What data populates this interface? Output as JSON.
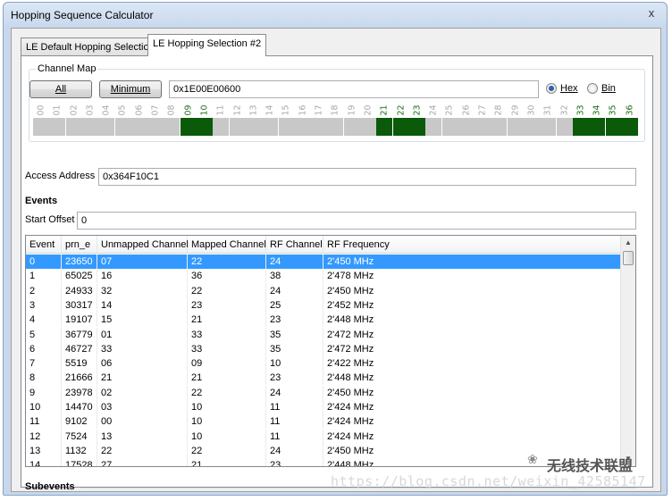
{
  "window": {
    "title": "Hopping Sequence Calculator",
    "close_glyph": "x"
  },
  "tabs": [
    {
      "label": "LE Default Hopping Selection",
      "active": false
    },
    {
      "label": "LE Hopping Selection #2",
      "active": true
    }
  ],
  "channel_map": {
    "group_title": "Channel Map",
    "all_label": "All",
    "minimum_label": "Minimum",
    "value": "0x1E00E00600",
    "hex_label": "Hex",
    "bin_label": "Bin",
    "selected_format": "Hex",
    "channels": [
      {
        "n": "00",
        "on": false
      },
      {
        "n": "01",
        "on": false
      },
      {
        "n": "02",
        "on": false
      },
      {
        "n": "03",
        "on": false
      },
      {
        "n": "04",
        "on": false
      },
      {
        "n": "05",
        "on": false
      },
      {
        "n": "06",
        "on": false
      },
      {
        "n": "07",
        "on": false
      },
      {
        "n": "08",
        "on": false
      },
      {
        "n": "09",
        "on": true
      },
      {
        "n": "10",
        "on": true
      },
      {
        "n": "11",
        "on": false
      },
      {
        "n": "12",
        "on": false
      },
      {
        "n": "13",
        "on": false
      },
      {
        "n": "14",
        "on": false
      },
      {
        "n": "15",
        "on": false
      },
      {
        "n": "16",
        "on": false
      },
      {
        "n": "17",
        "on": false
      },
      {
        "n": "18",
        "on": false
      },
      {
        "n": "19",
        "on": false
      },
      {
        "n": "20",
        "on": false
      },
      {
        "n": "21",
        "on": true
      },
      {
        "n": "22",
        "on": true
      },
      {
        "n": "23",
        "on": true
      },
      {
        "n": "24",
        "on": false
      },
      {
        "n": "25",
        "on": false
      },
      {
        "n": "26",
        "on": false
      },
      {
        "n": "27",
        "on": false
      },
      {
        "n": "28",
        "on": false
      },
      {
        "n": "29",
        "on": false
      },
      {
        "n": "30",
        "on": false
      },
      {
        "n": "31",
        "on": false
      },
      {
        "n": "32",
        "on": false
      },
      {
        "n": "33",
        "on": true
      },
      {
        "n": "34",
        "on": true
      },
      {
        "n": "35",
        "on": true
      },
      {
        "n": "36",
        "on": true
      }
    ],
    "on_color": "#0a5a0a",
    "off_color": "#c8c8c8"
  },
  "access_address": {
    "label": "Access Address",
    "value": "0x364F10C1"
  },
  "events": {
    "heading": "Events",
    "start_offset_label": "Start Offset",
    "start_offset_value": "0",
    "columns": [
      "Event",
      "prn_e",
      "Unmapped Channel",
      "Mapped Channel",
      "RF Channel",
      "RF Frequency"
    ],
    "rows": [
      [
        "0",
        "23650",
        "07",
        "22",
        "24",
        "2'450 MHz"
      ],
      [
        "1",
        "65025",
        "16",
        "36",
        "38",
        "2'478 MHz"
      ],
      [
        "2",
        "24933",
        "32",
        "22",
        "24",
        "2'450 MHz"
      ],
      [
        "3",
        "30317",
        "14",
        "23",
        "25",
        "2'452 MHz"
      ],
      [
        "4",
        "19107",
        "15",
        "21",
        "23",
        "2'448 MHz"
      ],
      [
        "5",
        "36779",
        "01",
        "33",
        "35",
        "2'472 MHz"
      ],
      [
        "6",
        "46727",
        "33",
        "33",
        "35",
        "2'472 MHz"
      ],
      [
        "7",
        "5519",
        "06",
        "09",
        "10",
        "2'422 MHz"
      ],
      [
        "8",
        "21666",
        "21",
        "21",
        "23",
        "2'448 MHz"
      ],
      [
        "9",
        "23978",
        "02",
        "22",
        "24",
        "2'450 MHz"
      ],
      [
        "10",
        "14470",
        "03",
        "10",
        "11",
        "2'424 MHz"
      ],
      [
        "11",
        "9102",
        "00",
        "10",
        "11",
        "2'424 MHz"
      ],
      [
        "12",
        "7524",
        "13",
        "10",
        "11",
        "2'424 MHz"
      ],
      [
        "13",
        "1132",
        "22",
        "22",
        "24",
        "2'450 MHz"
      ],
      [
        "14",
        "17528",
        "27",
        "21",
        "23",
        "2'448 MHz"
      ]
    ],
    "selected_row": 0
  },
  "subevents": {
    "heading": "Subevents"
  },
  "watermark": {
    "logo_glyph": "❀",
    "brand_text": "无线技术联盟",
    "url_text": "https://blog.csdn.net/weixin_42585147"
  }
}
